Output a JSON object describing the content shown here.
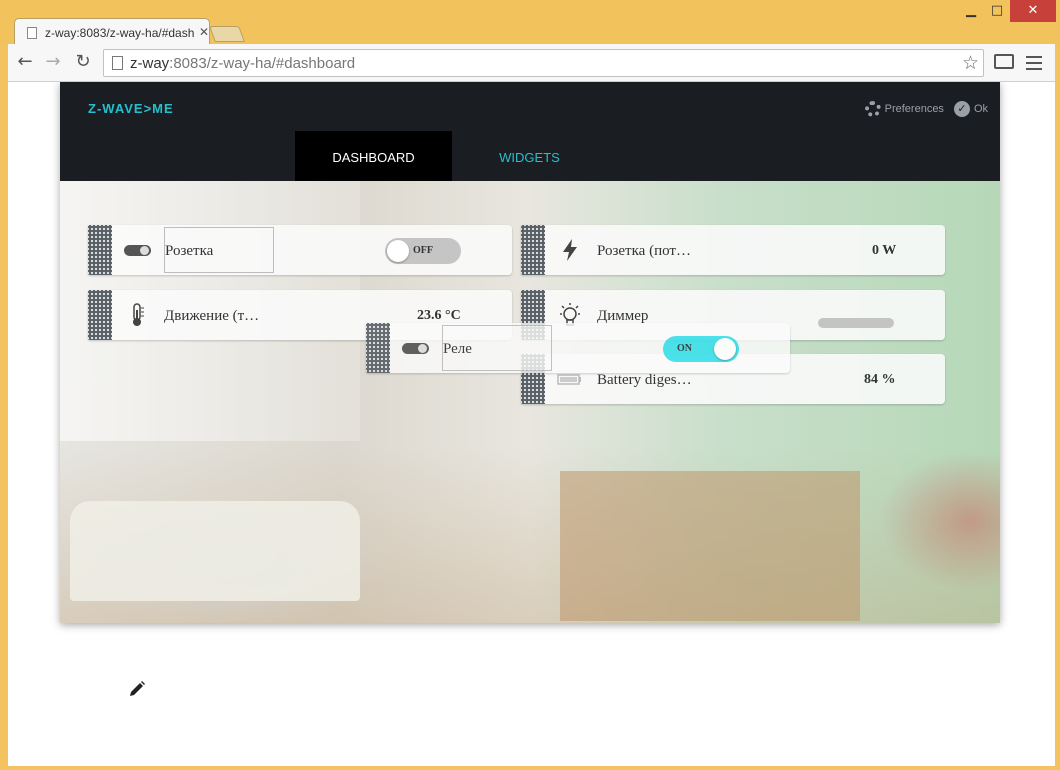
{
  "browser": {
    "tab_title": "z-way:8083/z-way-ha/#dashboard",
    "tab_close": "✕",
    "url_host": "z-way",
    "url_rest": ":8083/z-way-ha/#dashboard",
    "win_min": "▁",
    "win_max": "□",
    "win_close": "✕"
  },
  "app": {
    "logo": "Z-WAVE>ME",
    "preferences_label": "Preferences",
    "ok_label": "Ok",
    "tabs": [
      {
        "label": "DASHBOARD",
        "active": true
      },
      {
        "label": "WIDGETS",
        "active": false
      }
    ]
  },
  "widgets": {
    "rozetka": {
      "title": "Розетка",
      "switch": "OFF",
      "icon": "toggle-icon"
    },
    "rozetka_power": {
      "title": "Розетка (пот…",
      "value": "0 W",
      "icon": "lightning-icon"
    },
    "motion": {
      "title": "Движение (т…",
      "value": "23.6 °C",
      "icon": "thermometer-icon"
    },
    "dimmer": {
      "title": "Диммер",
      "level": 0,
      "icon": "bulb-icon"
    },
    "rele": {
      "title": "Реле",
      "switch": "ON",
      "icon": "toggle-icon"
    },
    "battery": {
      "title": "Battery diges…",
      "value": "84 %",
      "icon": "battery-icon"
    }
  },
  "colors": {
    "accent": "#26c0cc",
    "switch_on": "#3ee0ea",
    "header_bg": "#1a1d21"
  }
}
